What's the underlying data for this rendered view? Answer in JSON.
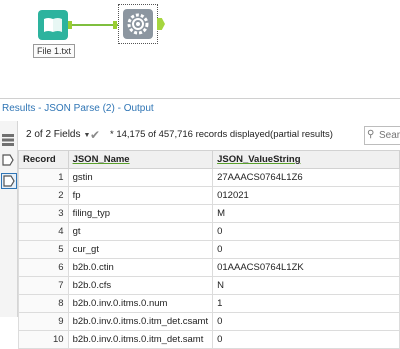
{
  "canvas": {
    "input_tool_label": "File 1.txt"
  },
  "results": {
    "title": "Results - JSON Parse (2) - Output",
    "fields_selector": "2 of 2 Fields",
    "records_text": "* 14,175 of 457,716 records displayed(partial results)",
    "search_placeholder": "Search"
  },
  "table": {
    "columns": [
      "Record",
      "JSON_Name",
      "JSON_ValueString"
    ],
    "rows": [
      {
        "record": "1",
        "name": "gstin",
        "value": "27AAACS0764L1Z6"
      },
      {
        "record": "2",
        "name": "fp",
        "value": "012021"
      },
      {
        "record": "3",
        "name": "filing_typ",
        "value": "M"
      },
      {
        "record": "4",
        "name": "gt",
        "value": "0"
      },
      {
        "record": "5",
        "name": "cur_gt",
        "value": "0"
      },
      {
        "record": "6",
        "name": "b2b.0.ctin",
        "value": "01AAACS0764L1ZK"
      },
      {
        "record": "7",
        "name": "b2b.0.cfs",
        "value": "N"
      },
      {
        "record": "8",
        "name": "b2b.0.inv.0.itms.0.num",
        "value": "1"
      },
      {
        "record": "9",
        "name": "b2b.0.inv.0.itms.0.itm_det.csamt",
        "value": "0"
      },
      {
        "record": "10",
        "name": "b2b.0.inv.0.itms.0.itm_det.samt",
        "value": "0"
      }
    ]
  },
  "colors": {
    "input_tool": "#2db39e",
    "parse_tool": "#8c96a0",
    "connector": "#7fbf3f",
    "results_title": "#2f75b5"
  }
}
